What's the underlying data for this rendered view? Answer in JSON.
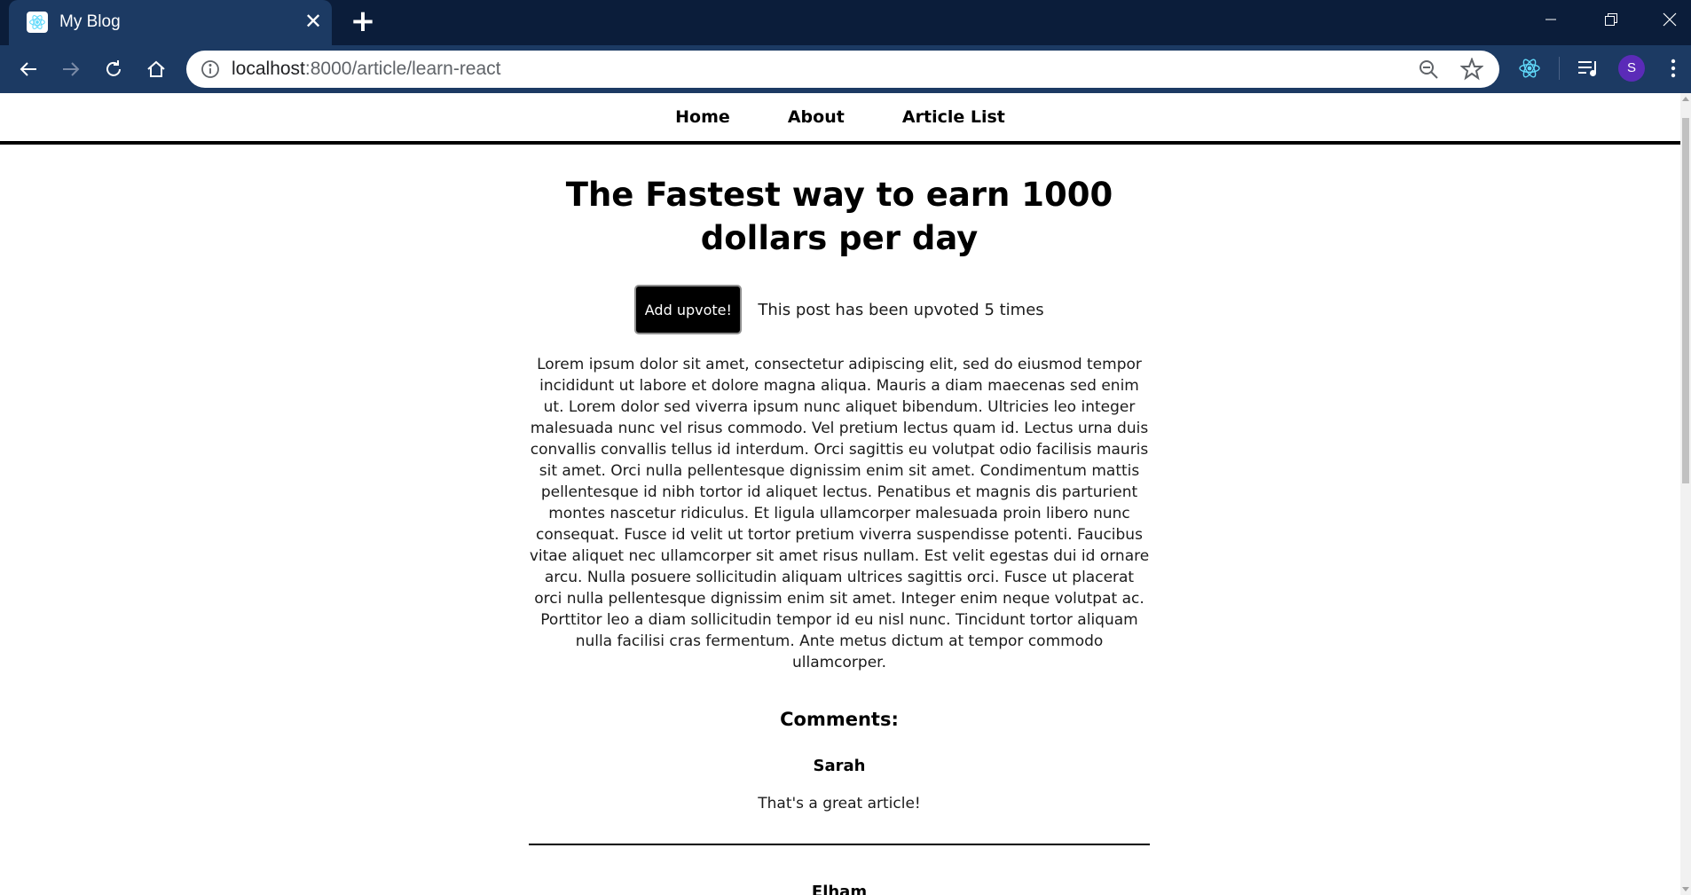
{
  "browser": {
    "tab_title": "My Blog",
    "url_host": "localhost",
    "url_path": ":8000/article/learn-react",
    "avatar_initial": "S"
  },
  "nav": {
    "items": [
      {
        "label": "Home"
      },
      {
        "label": "About"
      },
      {
        "label": "Article List"
      }
    ]
  },
  "article": {
    "title": "The Fastest way to earn 1000 dollars per day",
    "upvote_button_label": "Add upvote!",
    "upvote_text": "This post has been upvoted 5 times",
    "body": "Lorem ipsum dolor sit amet, consectetur adipiscing elit, sed do eiusmod tempor incididunt ut labore et dolore magna aliqua. Mauris a diam maecenas sed enim ut. Lorem dolor sed viverra ipsum nunc aliquet bibendum. Ultricies leo integer malesuada nunc vel risus commodo. Vel pretium lectus quam id. Lectus urna duis convallis convallis tellus id interdum. Orci sagittis eu volutpat odio facilisis mauris sit amet. Orci nulla pellentesque dignissim enim sit amet. Condimentum mattis pellentesque id nibh tortor id aliquet lectus. Penatibus et magnis dis parturient montes nascetur ridiculus. Et ligula ullamcorper malesuada proin libero nunc consequat. Fusce id velit ut tortor pretium viverra suspendisse potenti. Faucibus vitae aliquet nec ullamcorper sit amet risus nullam. Est velit egestas dui id ornare arcu. Nulla posuere sollicitudin aliquam ultrices sagittis orci. Fusce ut placerat orci nulla pellentesque dignissim enim sit amet. Integer enim neque volutpat ac. Porttitor leo a diam sollicitudin tempor id eu nisl nunc. Tincidunt tortor aliquam nulla facilisi cras fermentum. Ante metus dictum at tempor commodo ullamcorper."
  },
  "comments": {
    "heading": "Comments:",
    "items": [
      {
        "username": "Sarah",
        "text": "That's a great article!"
      },
      {
        "username": "Elham",
        "text": ""
      }
    ]
  },
  "colors": {
    "titlebar": "#0b1d3a",
    "toolbar": "#1c3a63",
    "button_bg": "#000000",
    "avatar": "#5b2bb8"
  },
  "icons": [
    "react-favicon-icon",
    "close-icon",
    "plus-icon",
    "minimize-icon",
    "maximize-icon",
    "window-close-icon",
    "back-arrow-icon",
    "forward-arrow-icon",
    "reload-icon",
    "home-icon",
    "info-icon",
    "zoom-out-icon",
    "star-icon",
    "react-extension-icon",
    "media-control-icon",
    "more-vertical-icon"
  ]
}
